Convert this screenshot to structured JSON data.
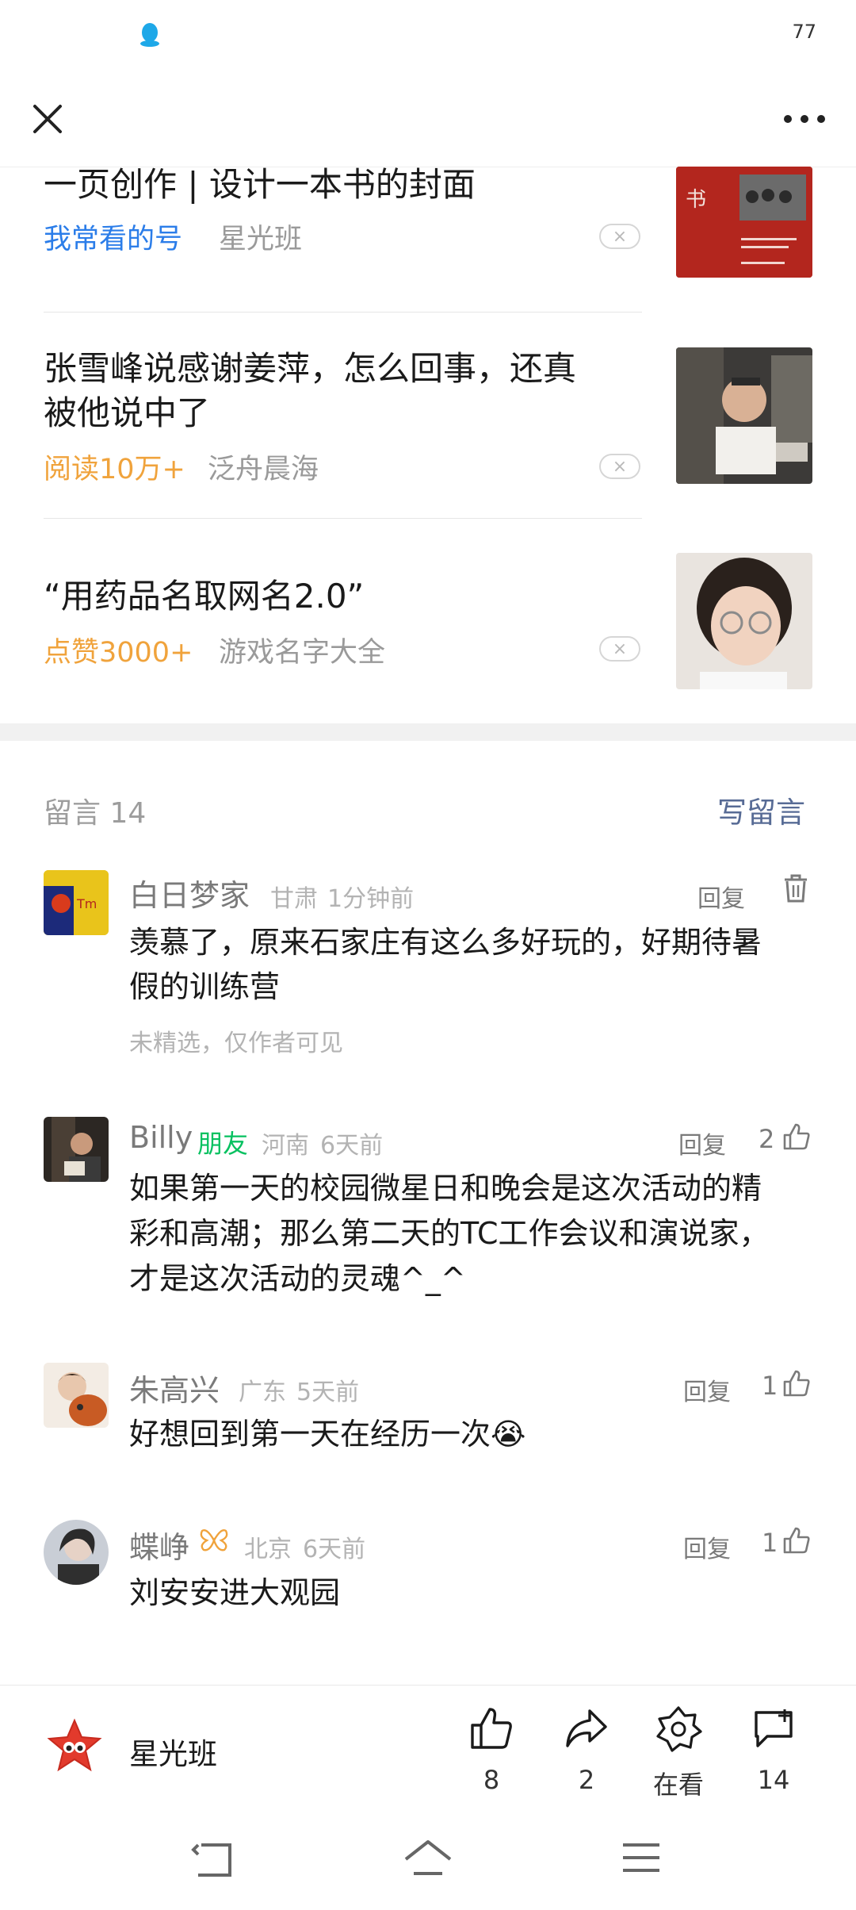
{
  "status_bar": {
    "battery": "77"
  },
  "colors": {
    "accent_blue": "#576b95",
    "friend_green": "#07c160",
    "orange": "#f0a33c",
    "blue": "#2b7de9"
  },
  "related_articles": [
    {
      "title": "一页创作 | 设计一本书的封面",
      "tag": "我常看的号",
      "source": "星光班",
      "dismiss": "×"
    },
    {
      "title_line1": "张雪峰说感谢姜萍，怎么回事，还真",
      "title_line2": "被他说中了",
      "tag": "阅读10万+",
      "source": "泛舟晨海",
      "dismiss": "×"
    },
    {
      "title": "“用药品名取网名2.0”",
      "tag": "点赞3000+",
      "source": "游戏名字大全",
      "dismiss": "×"
    }
  ],
  "comments_section": {
    "title": "留言 14",
    "write_label": "写留言",
    "items": [
      {
        "name": "白日梦家",
        "location": "甘肃",
        "time": "1分钟前",
        "reply": "回复",
        "line1": "羡慕了，原来石家庄有这么多好玩的，好期待暑",
        "line2": "假的训练营",
        "note": "未精选，仅作者可见"
      },
      {
        "name": "Billy",
        "tag": "朋友",
        "location": "河南",
        "time": "6天前",
        "reply": "回复",
        "likes": "2",
        "line1": "如果第一天的校园微星日和晚会是这次活动的精",
        "line2": "彩和高潮；那么第二天的TC工作会议和演说家，",
        "line3": "才是这次活动的灵魂^_^"
      },
      {
        "name": "朱高兴",
        "location": "广东",
        "time": "5天前",
        "reply": "回复",
        "likes": "1",
        "line1": "好想回到第一天在经历一次😭"
      },
      {
        "name": "蝶峥",
        "location": "北京",
        "time": "6天前",
        "reply": "回复",
        "likes": "1",
        "line1": "刘安安进大观园"
      }
    ]
  },
  "bottom_bar": {
    "account": "星光班",
    "like_count": "8",
    "share_count": "2",
    "wow_label": "在看",
    "comment_count": "14"
  },
  "icons": [
    "qq-icon",
    "close-icon",
    "more-icon",
    "like-icon",
    "share-icon",
    "wow-icon",
    "comment-icon",
    "trash-icon",
    "butterfly-icon",
    "back-icon",
    "home-icon",
    "menu-icon"
  ]
}
